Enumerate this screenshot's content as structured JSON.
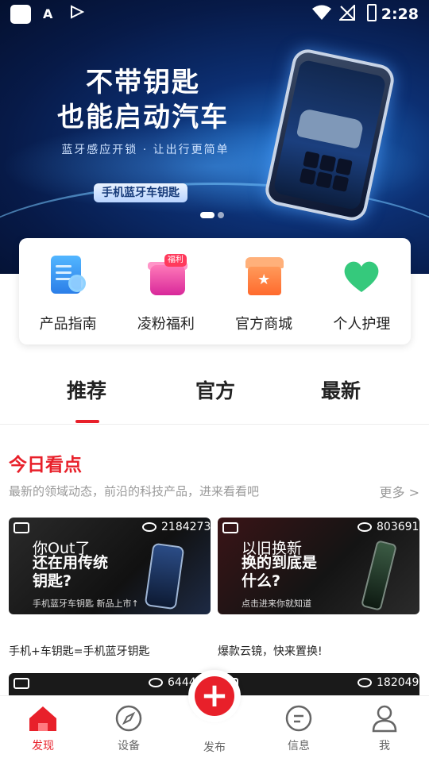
{
  "status": {
    "time": "2:28",
    "app_icon_letter": "A"
  },
  "banner": {
    "headline_1": "不带钥匙",
    "headline_2": "也能启动汽车",
    "subline": "蓝牙感应开锁 · 让出行更简单",
    "pill": "手机蓝牙车钥匙",
    "active_slide": 1,
    "slide_count": 2
  },
  "shortcuts": [
    {
      "label": "产品指南",
      "icon": "guide-icon"
    },
    {
      "label": "凌粉福利",
      "icon": "gift-icon",
      "badge": "福利"
    },
    {
      "label": "官方商城",
      "icon": "store-icon"
    },
    {
      "label": "个人护理",
      "icon": "heart-icon"
    }
  ],
  "tabs": [
    "推荐",
    "官方",
    "最新"
  ],
  "active_tab": "推荐",
  "section": {
    "title": "今日看点",
    "subtitle": "最新的领域动态，前沿的科技产品，进来看看吧",
    "more": "更多 >"
  },
  "cards": [
    {
      "views": "2184273",
      "line1": "你Out了",
      "line2": "还在用传统钥匙?",
      "sub": "手机蓝牙车钥匙 新品上市↑",
      "caption": "手机+车钥匙=手机蓝牙钥匙"
    },
    {
      "views": "803691",
      "line1": "以旧换新",
      "line2": "换的到底是什么?",
      "sub": "点击进来你就知道",
      "caption": "爆款云镜，快来置换!"
    },
    {
      "views": "64446"
    },
    {
      "views": "182049"
    }
  ],
  "nav": [
    {
      "label": "发现",
      "icon": "home-icon"
    },
    {
      "label": "设备",
      "icon": "compass-icon"
    },
    {
      "label": "发布",
      "icon": "plus-icon"
    },
    {
      "label": "信息",
      "icon": "message-icon"
    },
    {
      "label": "我",
      "icon": "user-icon"
    }
  ],
  "colors": {
    "accent": "#e8202a",
    "banner": "#0c2f72"
  }
}
